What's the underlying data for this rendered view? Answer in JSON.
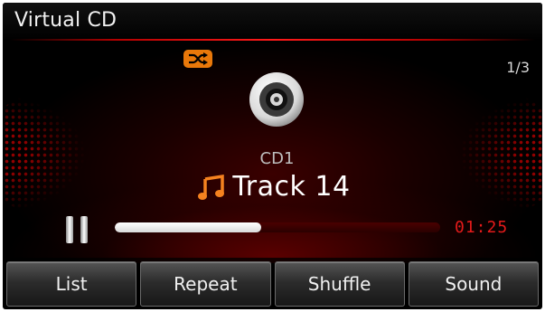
{
  "app": {
    "title": "Virtual CD"
  },
  "status": {
    "page_indicator": "1/3",
    "shuffle_active": true
  },
  "now_playing": {
    "disc_label": "CD1",
    "track_name": "Track 14",
    "elapsed_time": "01:25",
    "progress_percent": 45,
    "play_state": "paused"
  },
  "icons": {
    "shuffle": "shuffle-icon",
    "disc": "disc-icon",
    "note": "music-note-icon",
    "pause": "pause-icon"
  },
  "colors": {
    "accent_red": "#e31a1a",
    "shuffle_badge": "#e8780a",
    "note": "#f5821f"
  },
  "buttons": [
    {
      "label": "List"
    },
    {
      "label": "Repeat"
    },
    {
      "label": "Shuffle"
    },
    {
      "label": "Sound"
    }
  ]
}
